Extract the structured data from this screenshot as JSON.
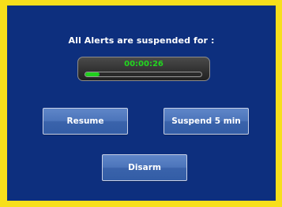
{
  "dialog": {
    "title": "All Alerts are suspended for :",
    "timer": "00:00:26",
    "progress_fraction": 0.12
  },
  "buttons": {
    "resume": "Resume",
    "suspend": "Suspend 5 min",
    "disarm": "Disarm"
  },
  "colors": {
    "frame": "#f7df1b",
    "panel": "#0d2f7e",
    "timer_text": "#22d61f",
    "progress_fill": "#21d01e",
    "button": "#4c75bb"
  }
}
